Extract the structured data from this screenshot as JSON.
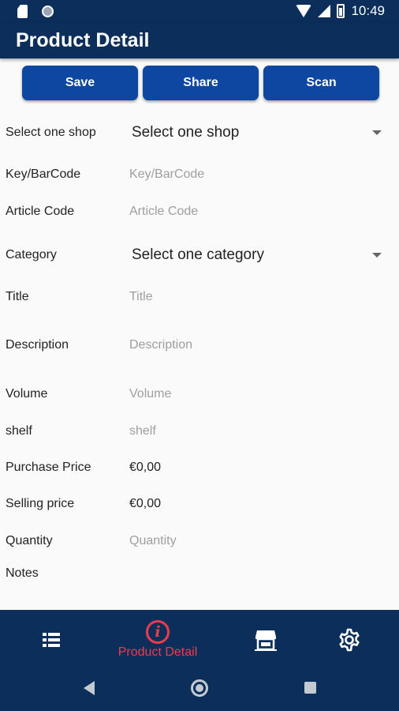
{
  "status_bar": {
    "time": "10:49",
    "icons": [
      "sd-card-icon",
      "circle-icon",
      "wifi-icon",
      "signal-icon",
      "battery-icon"
    ]
  },
  "app_bar": {
    "title": "Product Detail"
  },
  "actions": {
    "save_label": "Save",
    "share_label": "Share",
    "scan_label": "Scan"
  },
  "form": {
    "shop": {
      "label": "Select one shop",
      "value": "Select one shop"
    },
    "barcode": {
      "label": "Key/BarCode",
      "placeholder": "Key/BarCode"
    },
    "article_code": {
      "label": "Article Code",
      "placeholder": "Article Code"
    },
    "category": {
      "label": "Category",
      "value": "Select one category"
    },
    "title": {
      "label": "Title",
      "placeholder": "Title"
    },
    "description": {
      "label": "Description",
      "placeholder": "Description"
    },
    "volume": {
      "label": "Volume",
      "placeholder": "Volume"
    },
    "shelf": {
      "label": "shelf",
      "placeholder": "shelf"
    },
    "purchase_price": {
      "label": "Purchase Price",
      "value": "€0,00"
    },
    "selling_price": {
      "label": "Selling price",
      "value": "€0,00"
    },
    "quantity": {
      "label": "Quantity",
      "placeholder": "Quantity"
    },
    "notes": {
      "label": "Notes"
    }
  },
  "bottom_nav": {
    "items": [
      {
        "icon": "list-icon",
        "label": ""
      },
      {
        "icon": "info-icon",
        "label": "Product Detail",
        "active": true
      },
      {
        "icon": "store-icon",
        "label": ""
      },
      {
        "icon": "gear-icon",
        "label": ""
      }
    ]
  },
  "colors": {
    "primary": "#0b2f5a",
    "button": "#0d47a1",
    "accent": "#ef3b4b",
    "placeholder": "#9e9e9e"
  }
}
